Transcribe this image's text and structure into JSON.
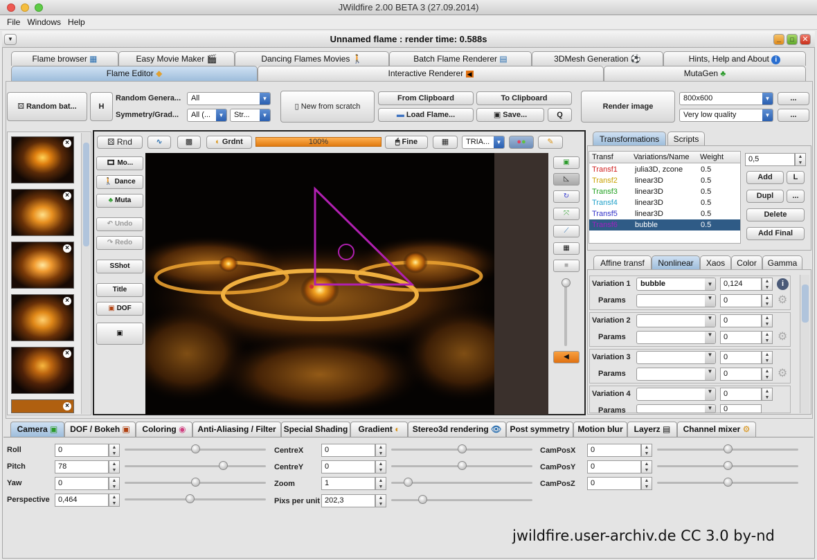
{
  "app": {
    "title": "JWildfire 2.00 BETA 3 (27.09.2014)",
    "frame_title": "Unnamed flame : render time: 0.588s"
  },
  "menu": [
    "File",
    "Windows",
    "Help"
  ],
  "main_tabs_top": [
    "Flame browser",
    "Easy Movie Maker",
    "Dancing Flames Movies",
    "Batch Flame Renderer",
    "3DMesh Generation",
    "Hints, Help and About"
  ],
  "main_tabs_bottom": [
    "Flame Editor",
    "Interactive Renderer",
    "MutaGen"
  ],
  "toolbar": {
    "random_batch": "Random bat...",
    "h": "H",
    "random_gen_label": "Random Genera...",
    "random_gen_value": "All",
    "symmetry_label": "Symmetry/Grad...",
    "symmetry_value": "All (...",
    "symmetry_value2": "Str...",
    "new_from_scratch": "New from scratch",
    "from_clipboard": "From Clipboard",
    "to_clipboard": "To Clipboard",
    "load_flame": "Load Flame...",
    "save": "Save...",
    "q": "Q",
    "render_image": "Render image",
    "resolution": "800x600",
    "quality": "Very low quality",
    "more1": "...",
    "more2": "..."
  },
  "editor_toolbar": {
    "rnd": "Rnd",
    "gradient": "Grdnt",
    "progress_label": "100%",
    "progress": 1.0,
    "fine": "Fine",
    "triangle_mode": "TRIA..."
  },
  "side_buttons": [
    "Mo...",
    "Dance",
    "Muta",
    "Undo",
    "Redo",
    "SShot",
    "Title",
    "DOF"
  ],
  "right_tabs": [
    "Transformations",
    "Scripts"
  ],
  "transforms": {
    "headers": [
      "Transf",
      "Variations/Name",
      "Weight"
    ],
    "rows": [
      {
        "name": "Transf1",
        "var": "julia3D, zcone",
        "weight": "0.5",
        "color": "#d02020"
      },
      {
        "name": "Transf2",
        "var": "linear3D",
        "weight": "0.5",
        "color": "#c8a000"
      },
      {
        "name": "Transf3",
        "var": "linear3D",
        "weight": "0.5",
        "color": "#20a020"
      },
      {
        "name": "Transf4",
        "var": "linear3D",
        "weight": "0.5",
        "color": "#20a0c8"
      },
      {
        "name": "Transf5",
        "var": "linear3D",
        "weight": "0.5",
        "color": "#3030c8"
      },
      {
        "name": "Transf6",
        "var": "bubble",
        "weight": "0.5",
        "color": "#a020c0"
      }
    ],
    "value": "0,5",
    "add": "Add",
    "l": "L",
    "dupl": "Dupl",
    "dots": "...",
    "delete": "Delete",
    "add_final": "Add Final"
  },
  "sub_tabs": [
    "Affine transf",
    "Nonlinear",
    "Xaos",
    "Color",
    "Gamma"
  ],
  "variations": [
    {
      "label": "Variation 1",
      "name": "bubble",
      "amount": "0,124",
      "params_label": "Params",
      "param": "0"
    },
    {
      "label": "Variation 2",
      "name": "",
      "amount": "0",
      "params_label": "Params",
      "param": "0"
    },
    {
      "label": "Variation 3",
      "name": "",
      "amount": "0",
      "params_label": "Params",
      "param": "0"
    },
    {
      "label": "Variation 4",
      "name": "",
      "amount": "0",
      "params_label": "Params",
      "param": "0"
    }
  ],
  "bottom_tabs": [
    "Camera",
    "DOF / Bokeh",
    "Coloring",
    "Anti-Aliasing / Filter",
    "Special Shading",
    "Gradient",
    "Stereo3d rendering",
    "Post symmetry",
    "Motion blur",
    "Layerz",
    "Channel mixer"
  ],
  "camera": {
    "roll": {
      "label": "Roll",
      "value": "0"
    },
    "pitch": {
      "label": "Pitch",
      "value": "78"
    },
    "yaw": {
      "label": "Yaw",
      "value": "0"
    },
    "perspective": {
      "label": "Perspective",
      "value": "0,464"
    },
    "centrex": {
      "label": "CentreX",
      "value": "0"
    },
    "centrey": {
      "label": "CentreY",
      "value": "0"
    },
    "zoom": {
      "label": "Zoom",
      "value": "1"
    },
    "pixs": {
      "label": "Pixs per unit",
      "value": "202,3"
    },
    "camposx": {
      "label": "CamPosX",
      "value": "0"
    },
    "camposy": {
      "label": "CamPosY",
      "value": "0"
    },
    "camposz": {
      "label": "CamPosZ",
      "value": "0"
    }
  },
  "watermark": "jwildfire.user-archiv.de  CC 3.0 by-nd",
  "colors": {
    "accent": "#2a5fb0",
    "selected_row": "#2f5b86",
    "progress": "#e07a10",
    "triangle": "#b020b0"
  }
}
